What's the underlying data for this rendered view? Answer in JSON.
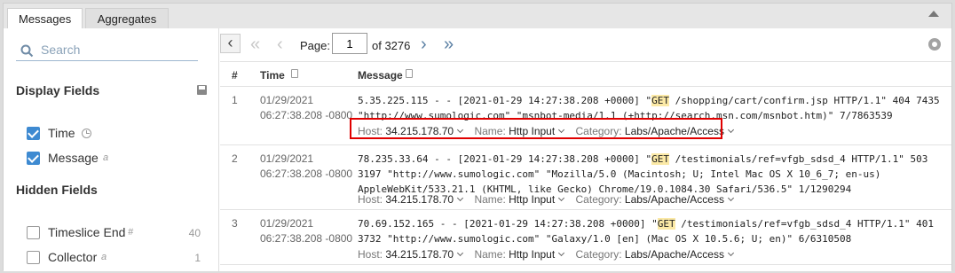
{
  "tabs": [
    {
      "label": "Messages",
      "active": true
    },
    {
      "label": "Aggregates",
      "active": false
    }
  ],
  "sidebar": {
    "search_placeholder": "Search",
    "display_title": "Display Fields",
    "display_fields": [
      {
        "label": "Time",
        "checked": true,
        "icon": "clock-icon"
      },
      {
        "label": "Message",
        "checked": true,
        "type": "a"
      }
    ],
    "hidden_title": "Hidden Fields",
    "hidden_fields": [
      {
        "label": "Timeslice End",
        "checked": false,
        "type": "#",
        "count": "40"
      },
      {
        "label": "Collector",
        "checked": false,
        "type": "a",
        "count": "1"
      }
    ]
  },
  "pager": {
    "page_label": "Page:",
    "page_value": "1",
    "of_label": "of 3276"
  },
  "table": {
    "headers": {
      "num": "#",
      "time": "Time",
      "message": "Message"
    },
    "rows": [
      {
        "num": "1",
        "date": "01/29/2021",
        "time": "06:27:38.208 -0800",
        "msg_pre": "5.35.225.115 - - [2021-01-29 14:27:38.208 +0000] \"",
        "msg_hl": "GET",
        "msg_post": " /shopping/cart/confirm.jsp HTTP/1.1\" 404 7435",
        "msg_line2": "\"http://www.sumologic.com\" \"msnbot-media/1.1 (+http://search.msn.com/msnbot.htm)\" 7/7863539",
        "host_key": "Host:",
        "host_val": "34.215.178.70",
        "name_key": "Name:",
        "name_val": "Http Input",
        "cat_key": "Category:",
        "cat_val": "Labs/Apache/Access"
      },
      {
        "num": "2",
        "date": "01/29/2021",
        "time": "06:27:38.208 -0800",
        "msg_pre": "78.235.33.64 - - [2021-01-29 14:27:38.208 +0000] \"",
        "msg_hl": "GET",
        "msg_post": " /testimonials/ref=vfgb_sdsd_4 HTTP/1.1\" 503",
        "msg_line2": "3197 \"http://www.sumologic.com\" \"Mozilla/5.0 (Macintosh; U; Intel Mac OS X 10_6_7; en-us)",
        "msg_line3": "AppleWebKit/533.21.1 (KHTML, like Gecko) Chrome/19.0.1084.30 Safari/536.5\" 1/1290294",
        "host_key": "Host:",
        "host_val": "34.215.178.70",
        "name_key": "Name:",
        "name_val": "Http Input",
        "cat_key": "Category:",
        "cat_val": "Labs/Apache/Access"
      },
      {
        "num": "3",
        "date": "01/29/2021",
        "time": "06:27:38.208 -0800",
        "msg_pre": "70.69.152.165 - - [2021-01-29 14:27:38.208 +0000] \"",
        "msg_hl": "GET",
        "msg_post": " /testimonials/ref=vfgb_sdsd_4 HTTP/1.1\" 401",
        "msg_line2": "3732 \"http://www.sumologic.com\" \"Galaxy/1.0 [en] (Mac OS X 10.5.6; U; en)\" 6/6310508",
        "host_key": "Host:",
        "host_val": "34.215.178.70",
        "name_key": "Name:",
        "name_val": "Http Input",
        "cat_key": "Category:",
        "cat_val": "Labs/Apache/Access"
      }
    ]
  },
  "colors": {
    "accent": "#3e8ad1",
    "highlight": "#fbe9a6",
    "annotation": "#e00000"
  }
}
